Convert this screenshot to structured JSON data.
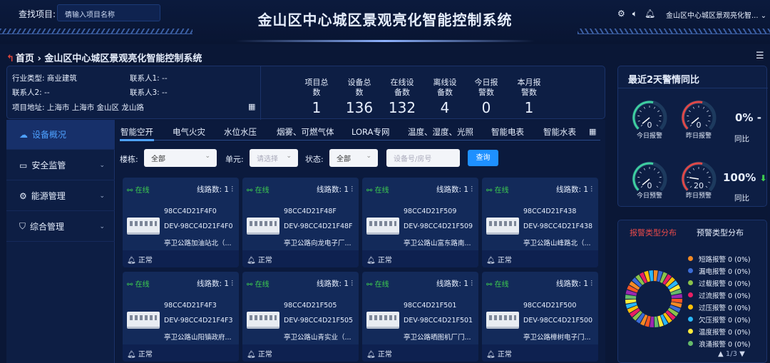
{
  "header": {
    "search_label": "查找项目:",
    "search_placeholder": "请输入项目名称",
    "title": "金山区中心城区景观亮化智能控制系统",
    "user": "金山区中心城区景观亮化智...",
    "user_chevron": "⌄"
  },
  "breadcrumb": {
    "home": "首页",
    "sep": "›",
    "current": "金山区中心城区景观亮化智能控制系统"
  },
  "info": {
    "industry": "行业类型:  商业建筑",
    "contact1": "联系人1:  --",
    "contact2": "联系人2:  --",
    "contact3": "联系人3:  --",
    "address": "项目地址:  上海市 上海市 金山区 龙山路"
  },
  "stats": [
    {
      "label1": "项目总",
      "label2": "数",
      "value": "1"
    },
    {
      "label1": "设备总",
      "label2": "数",
      "value": "136"
    },
    {
      "label1": "在线设",
      "label2": "备数",
      "value": "132"
    },
    {
      "label1": "离线设",
      "label2": "备数",
      "value": "4"
    },
    {
      "label1": "今日报",
      "label2": "警数",
      "value": "0"
    },
    {
      "label1": "本月报",
      "label2": "警数",
      "value": "1"
    }
  ],
  "menu": [
    {
      "label": "设备概况",
      "icon": "cloud-icon",
      "glyph": "☁",
      "active": true
    },
    {
      "label": "安全监管",
      "icon": "monitor-icon",
      "glyph": "▭",
      "active": false
    },
    {
      "label": "能源管理",
      "icon": "energy-icon",
      "glyph": "⚙",
      "active": false
    },
    {
      "label": "综合管理",
      "icon": "shield-icon",
      "glyph": "⛉",
      "active": false
    }
  ],
  "tabs": [
    "智能空开",
    "电气火灾",
    "水位水压",
    "烟雾、可燃气体",
    "LORA专网",
    "温度、湿度、光照",
    "智能电表",
    "智能水表"
  ],
  "filters": {
    "floor_label": "楼栋:",
    "floor_value": "全部",
    "unit_label": "单元:",
    "unit_placeholder": "请选择",
    "status_label": "状态:",
    "status_value": "全部",
    "device_placeholder": "设备号/房号",
    "query": "查询"
  },
  "cards": [
    {
      "status": "在线",
      "lines": "线路数: 1",
      "code": "98CC4D21F4F0",
      "dev": "DEV-98CC4D21F4F0",
      "addr": "亭卫公路加油站北（...",
      "footer": "正常"
    },
    {
      "status": "在线",
      "lines": "线路数: 1",
      "code": "98CC4D21F48F",
      "dev": "DEV-98CC4D21F48F",
      "addr": "亭卫公路向龙电子厂...",
      "footer": "正常"
    },
    {
      "status": "在线",
      "lines": "线路数: 1",
      "code": "98CC4D21F509",
      "dev": "DEV-98CC4D21F509",
      "addr": "亭卫公路山富东路南...",
      "footer": "正常"
    },
    {
      "status": "在线",
      "lines": "线路数: 1",
      "code": "98CC4D21F438",
      "dev": "DEV-98CC4D21F438",
      "addr": "亭卫公路山峰路北（...",
      "footer": "正常"
    },
    {
      "status": "在线",
      "lines": "线路数: 1",
      "code": "98CC4D21F4F3",
      "dev": "DEV-98CC4D21F4F3",
      "addr": "亭卫公路山阳镇政府...",
      "footer": "正常"
    },
    {
      "status": "在线",
      "lines": "线路数: 1",
      "code": "98CC4D21F505",
      "dev": "DEV-98CC4D21F505",
      "addr": "亭卫公路山青实业（...",
      "footer": "正常"
    },
    {
      "status": "在线",
      "lines": "线路数: 1",
      "code": "98CC4D21F501",
      "dev": "DEV-98CC4D21F501",
      "addr": "亭卫公路晒图机厂门...",
      "footer": "正常"
    },
    {
      "status": "在线",
      "lines": "线路数: 1",
      "code": "98CC4D21F500",
      "dev": "DEV-98CC4D21F500",
      "addr": "亭卫公路樟树电子门...",
      "footer": "正常"
    }
  ],
  "alarm_compare": {
    "title": "最近2天警情同比",
    "today_alarm_label": "今日报警",
    "today_alarm": "0",
    "yest_alarm_label": "昨日报警",
    "yest_alarm": "0",
    "alarm_pct": "0%",
    "alarm_trend": "-",
    "alarm_cmp": "同比",
    "today_warn_label": "今日预警",
    "today_warn": "0",
    "yest_warn_label": "昨日预警",
    "yest_warn": "20",
    "warn_pct": "100%",
    "warn_trend": "⬇",
    "warn_cmp": "同比",
    "gauge_colors": {
      "track": "#1d3a5e",
      "green": "#3ecfa0",
      "red": "#e04848"
    }
  },
  "distribution": {
    "tab1": "报警类型分布",
    "tab2": "预警类型分布",
    "legend": [
      {
        "label": "短路报警 0 (0%)",
        "color": "#f58a24"
      },
      {
        "label": "漏电报警 0 (0%)",
        "color": "#3b6cd6"
      },
      {
        "label": "过载报警 0 (0%)",
        "color": "#8bc34a"
      },
      {
        "label": "过流报警 0 (0%)",
        "color": "#e91e63"
      },
      {
        "label": "过压报警 0 (0%)",
        "color": "#ffc107"
      },
      {
        "label": "欠压报警 0 (0%)",
        "color": "#29b6f6"
      },
      {
        "label": "温度报警 0 (0%)",
        "color": "#ffeb3b"
      },
      {
        "label": "浪涌报警 0 (0%)",
        "color": "#66bb6a"
      }
    ],
    "pager": "1/3",
    "ring_colors": [
      "#f58a24",
      "#3b6cd6",
      "#8bc34a",
      "#e91e63",
      "#ffc107",
      "#29b6f6",
      "#ffeb3b",
      "#66bb6a",
      "#9c27b0",
      "#ff5722"
    ]
  }
}
